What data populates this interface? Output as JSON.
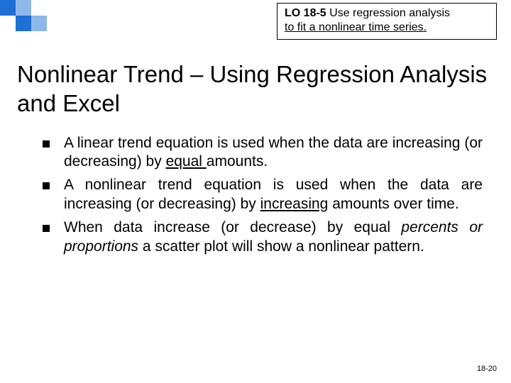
{
  "header": {
    "lo_code": "LO 18-5",
    "lo_text_1": "Use regression analysis",
    "lo_text_2": "to fit a nonlinear time series."
  },
  "title": "Nonlinear Trend – Using Regression Analysis and Excel",
  "bullets": [
    {
      "pre": "A linear trend equation is used when the data are increasing (or decreasing) by ",
      "u": "equal ",
      "post": "amounts."
    },
    {
      "pre": "A nonlinear trend equation is used when the data are increasing (or decreasing) by ",
      "u": "increasing",
      "post": " amounts over time."
    },
    {
      "pre": "When data increase (or decrease) by equal ",
      "em": "percents or proportions",
      "post": " a scatter plot will show a nonlinear pattern."
    }
  ],
  "pagenum": "18-20"
}
